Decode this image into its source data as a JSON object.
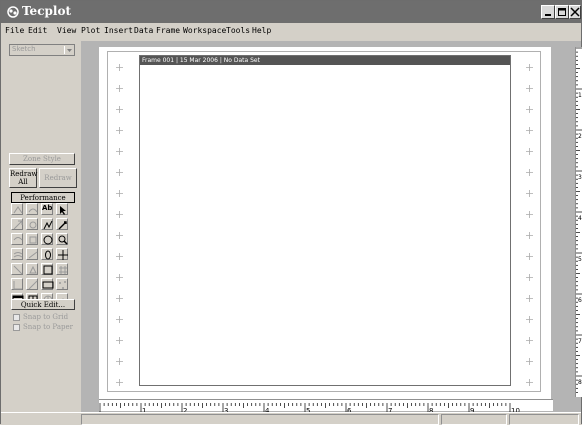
{
  "window": {
    "title": "Tecplot"
  },
  "menu": [
    "File",
    "Edit",
    "View",
    "Plot",
    "Insert",
    "Data",
    "Frame",
    "Workspace",
    "Tools",
    "Help"
  ],
  "sidebar": {
    "mode_combo": "Sketch",
    "zone_style": "Zone Style",
    "redraw_all": [
      "Redraw",
      "All"
    ],
    "redraw": "Redraw",
    "performance": "Performance",
    "quick_edit": "Quick Edit...",
    "snap_grid": "Snap to Grid",
    "snap_paper": "Snap to Paper",
    "text_tool": "Ab"
  },
  "frame": {
    "header": "Frame 001 | 15 Mar 2006 | No Data Set"
  },
  "ruler": {
    "h_labels": [
      "1",
      "2",
      "3",
      "4",
      "5",
      "6",
      "7",
      "8",
      "9",
      "10"
    ],
    "v_labels": [
      "1",
      "2",
      "3",
      "4",
      "5",
      "6",
      "7",
      "8"
    ]
  },
  "colors": {
    "titlebar": "#6e6e6e",
    "workspace": "#b4b4b4",
    "panel": "#d4d0c8",
    "frame_header": "#555555"
  }
}
